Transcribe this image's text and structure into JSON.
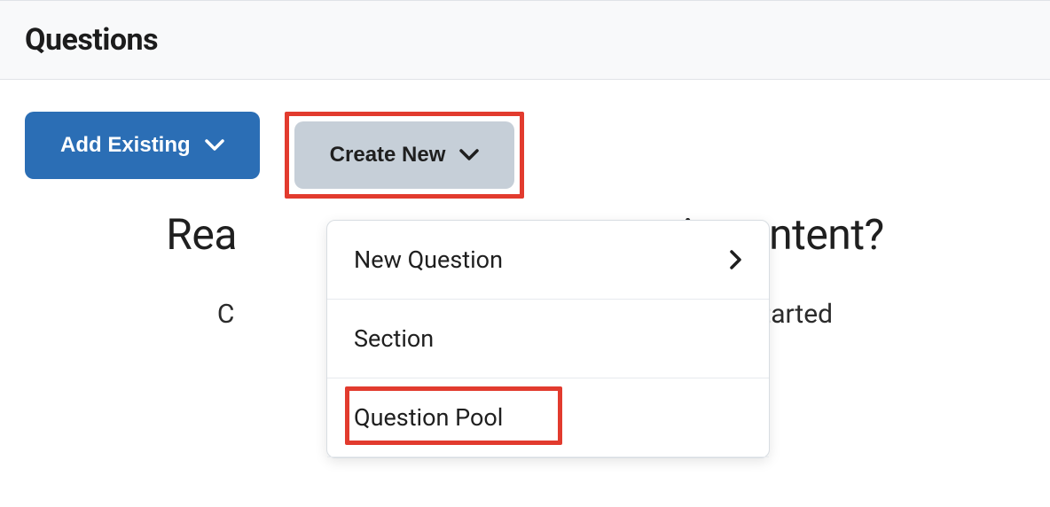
{
  "header": {
    "title": "Questions"
  },
  "buttons": {
    "add_existing": "Add Existing",
    "create_new": "Create New"
  },
  "dropdown": {
    "items": [
      {
        "label": "New Question",
        "has_submenu": true
      },
      {
        "label": "Section",
        "has_submenu": false
      },
      {
        "label": "Question Pool",
        "has_submenu": false
      }
    ]
  },
  "background": {
    "heading_left": "Rea",
    "heading_right": "iz content?",
    "sub_left": "C",
    "sub_right": "o get started"
  }
}
